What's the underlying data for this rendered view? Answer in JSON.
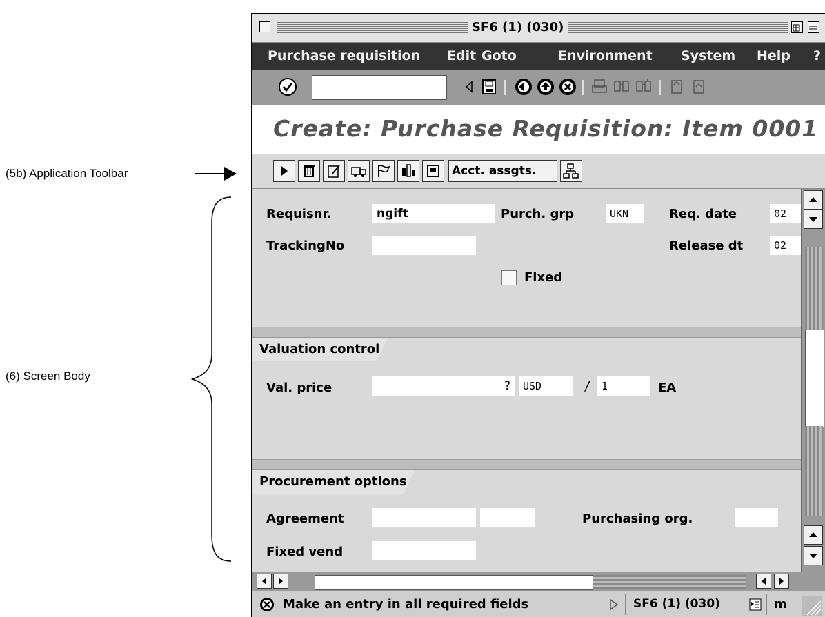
{
  "annotations": {
    "app_toolbar_label": "(5b) Application Toolbar",
    "screen_body_label": "(6) Screen Body"
  },
  "window": {
    "title": "SF6 (1) (030)"
  },
  "menu": [
    "Purchase requisition",
    "Edit",
    "Goto",
    "Environment",
    "System",
    "Help",
    "?"
  ],
  "system_toolbar": {
    "icons": [
      "enter-icon",
      "back-arrow-icon",
      "save-icon",
      "back-icon",
      "exit-icon",
      "cancel-icon",
      "print-icon",
      "find-icon",
      "find-next-icon",
      "first-page-icon",
      "prev-page-icon"
    ]
  },
  "header": {
    "title": "Create: Purchase Requisition: Item 0001"
  },
  "app_toolbar": {
    "acct_assgts_label": "Acct. assgts."
  },
  "fields": {
    "requisnr_label": "Requisnr.",
    "requisnr_value": "ngift",
    "purch_grp_label": "Purch. grp",
    "purch_grp_value": "UKN",
    "req_date_label": "Req. date",
    "req_date_value": "02",
    "tracking_label": "TrackingNo",
    "tracking_value": "",
    "release_label": "Release dt",
    "release_value": "02",
    "fixed_label": "Fixed"
  },
  "valuation": {
    "section_title": "Valuation control",
    "val_price_label": "Val. price",
    "price_value": "?",
    "currency": "USD",
    "slash": "/",
    "per_value": "1",
    "unit": "EA"
  },
  "procurement": {
    "section_title": "Procurement options",
    "agreement_label": "Agreement",
    "purch_org_label": "Purchasing org.",
    "fixed_vend_label": "Fixed vend"
  },
  "status": {
    "message": "Make an entry in all required fields",
    "session": "SF6 (1) (030)",
    "extra": "m"
  }
}
